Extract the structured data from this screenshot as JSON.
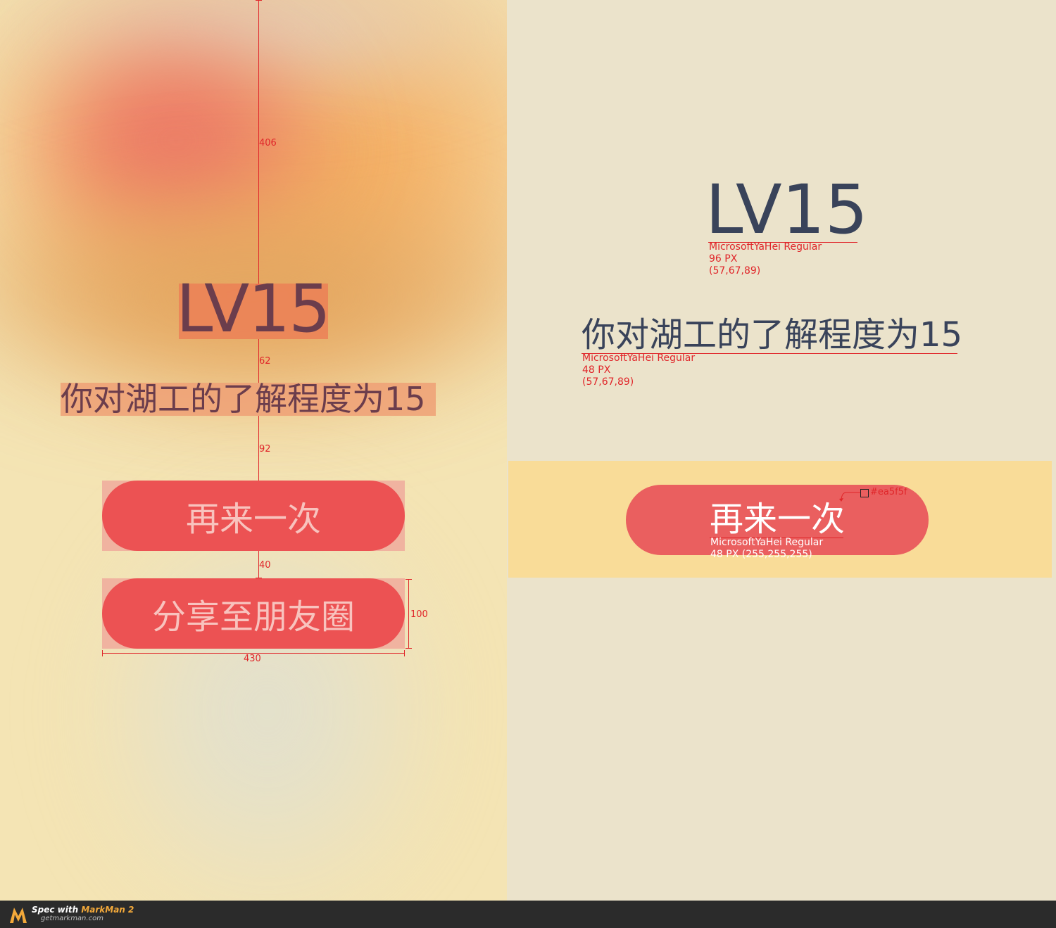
{
  "left": {
    "level": "LV15",
    "subtitle": "你对湖工的了解程度为15",
    "retry_label": "再来一次",
    "share_label": "分享至朋友圈",
    "measure_406": "406",
    "measure_62": "62",
    "measure_92": "92",
    "measure_40": "40",
    "measure_100": "100",
    "measure_430": "430"
  },
  "right": {
    "level": "LV15",
    "level_font": "MicrosoftYaHei Regular",
    "level_size": "96 PX",
    "level_color": "(57,67,89)",
    "subtitle": "你对湖工的了解程度为15",
    "subtitle_font": "MicrosoftYaHei Regular",
    "subtitle_size": "48 PX",
    "subtitle_color": "(57,67,89)",
    "button_label": "再来一次",
    "button_font": "MicrosoftYaHei Regular",
    "button_spec": "48 PX  (255,255,255)",
    "button_fill": "#ea5f5f"
  },
  "colors": {
    "text_dark": "#39435a",
    "button": "#ea5f5f",
    "measure_red": "#e0262a"
  },
  "footer": {
    "spec_prefix": "Spec with ",
    "product": "MarkMan 2",
    "url": "getmarkman.com"
  }
}
